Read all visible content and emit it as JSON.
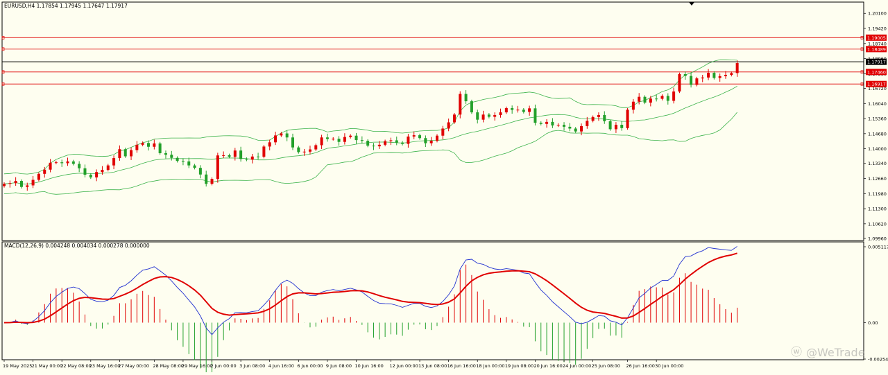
{
  "chart_data": [
    {
      "type": "candlestick",
      "title": "EURUSD,H4  1.17854 1.17945 1.17647 1.17917",
      "ylim": [
        1.0996,
        1.2042
      ],
      "y_ticks": [
        "1.20100",
        "1.19420",
        "1.18740",
        "1.18060",
        "1.17380",
        "1.16720",
        "1.16040",
        "1.15360",
        "1.14680",
        "1.14000",
        "1.13340",
        "1.12660",
        "1.11980",
        "1.11300",
        "1.10620",
        "1.09960"
      ],
      "price_lines": [
        {
          "value": 1.19005,
          "label": "1.19005",
          "color": "#e00000"
        },
        {
          "value": 1.18489,
          "label": "1.18489",
          "color": "#e00000"
        },
        {
          "value": 1.17917,
          "label": "1.17917",
          "color": "#000000"
        },
        {
          "value": 1.1746,
          "label": "1.17460",
          "color": "#e00000"
        },
        {
          "value": 1.16917,
          "label": "1.16917",
          "color": "#e00000"
        }
      ],
      "x_labels": [
        "19 May 2025",
        "21 May 00:00",
        "22 May 08:00",
        "23 May 16:00",
        "27 May 00:00",
        "28 May 08:00",
        "29 May 16:00",
        "2 Jun 00:00",
        "3 Jun 08:00",
        "4 Jun 16:00",
        "6 Jun 00:00",
        "9 Jun 08:00",
        "10 Jun 16:00",
        "12 Jun 00:00",
        "13 Jun 08:00",
        "16 Jun 16:00",
        "18 Jun 00:00",
        "19 Jun 08:00",
        "20 Jun 16:00",
        "24 Jun 00:00",
        "25 Jun 08:00",
        "26 Jun 16:00",
        "30 Jun 00:00"
      ],
      "bars": 118,
      "close": [
        1.1242,
        1.1245,
        1.1255,
        1.1228,
        1.1235,
        1.126,
        1.1287,
        1.1306,
        1.1337,
        1.1339,
        1.1335,
        1.1343,
        1.1332,
        1.1312,
        1.1283,
        1.1271,
        1.1295,
        1.1305,
        1.1325,
        1.1358,
        1.1398,
        1.1366,
        1.1394,
        1.1418,
        1.1426,
        1.1409,
        1.1424,
        1.138,
        1.1373,
        1.1359,
        1.1345,
        1.1343,
        1.1325,
        1.1314,
        1.1284,
        1.1242,
        1.1264,
        1.137,
        1.1371,
        1.1364,
        1.1392,
        1.1354,
        1.1351,
        1.1365,
        1.1364,
        1.141,
        1.1429,
        1.146,
        1.1469,
        1.1451,
        1.1406,
        1.1385,
        1.1387,
        1.1397,
        1.1416,
        1.1451,
        1.1444,
        1.1445,
        1.1431,
        1.1453,
        1.1459,
        1.1439,
        1.1436,
        1.1414,
        1.1411,
        1.1418,
        1.1434,
        1.1438,
        1.1428,
        1.1422,
        1.1455,
        1.1461,
        1.1448,
        1.1425,
        1.1436,
        1.1459,
        1.1491,
        1.1519,
        1.1554,
        1.1647,
        1.1614,
        1.1564,
        1.1531,
        1.1554,
        1.1544,
        1.1552,
        1.1564,
        1.1583,
        1.1575,
        1.1576,
        1.1566,
        1.1582,
        1.1517,
        1.1512,
        1.1521,
        1.1505,
        1.1508,
        1.1499,
        1.1491,
        1.1478,
        1.1502,
        1.1526,
        1.1543,
        1.1552,
        1.1524,
        1.1488,
        1.1508,
        1.1493,
        1.1576,
        1.1612,
        1.1634,
        1.1608,
        1.1626,
        1.1625,
        1.1638,
        1.1616,
        1.1658,
        1.1736,
        1.1728,
        1.1688,
        1.1717,
        1.1721,
        1.1742,
        1.1719,
        1.1727,
        1.1733,
        1.1741,
        1.1786
      ],
      "bollinger": {
        "period": 20,
        "deviations": 2,
        "color": "#3cb34a"
      },
      "colors": {
        "up": "#e00000",
        "down": "#22a02a",
        "background": "#fefef0"
      }
    },
    {
      "type": "macd",
      "title": "MACD(12,26,9) 0.004248 0.004034 0.000278 0.000000",
      "y_ticks": [
        "0.005117",
        "0.00",
        "-0.002548"
      ],
      "ylim": [
        -0.002548,
        0.005117
      ],
      "series": [
        {
          "name": "MACD",
          "color": "#2030d0"
        },
        {
          "name": "Signal",
          "color": "#e00000"
        },
        {
          "name": "Histogram",
          "up_color": "#e00000",
          "down_color": "#22a02a"
        }
      ]
    }
  ],
  "watermark": "@WeTrade"
}
